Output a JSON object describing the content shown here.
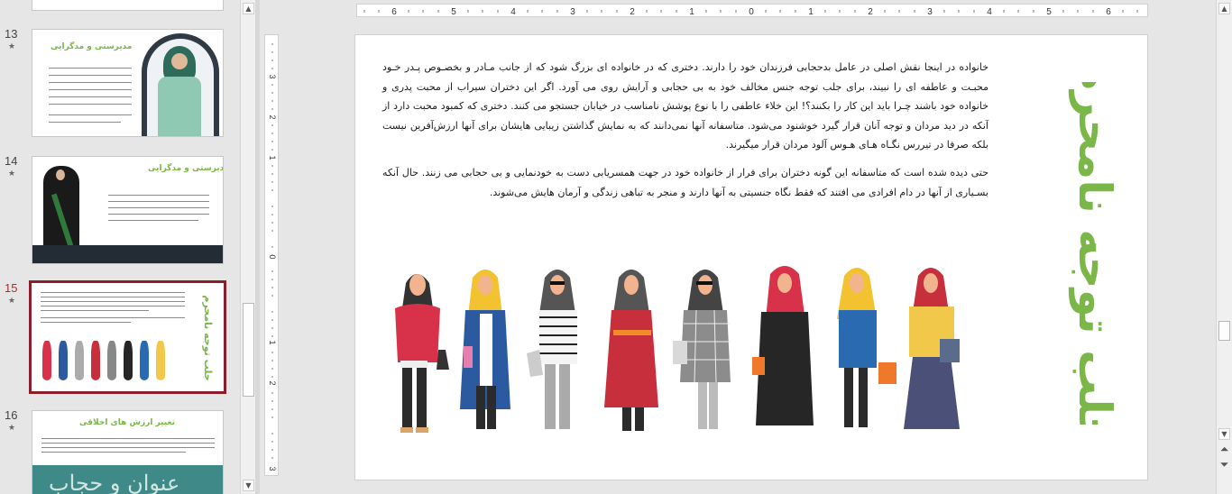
{
  "thumbnails": [
    {
      "num": "13",
      "star": "★",
      "title": "مدیرستی و مدگرایی"
    },
    {
      "num": "14",
      "star": "★",
      "title": "مدیرستی و مدگرایی"
    },
    {
      "num": "15",
      "star": "★",
      "title": "جلب توجه نامحرم"
    },
    {
      "num": "16",
      "star": "★",
      "title": "تغییر ارزش های اخلاقی",
      "image_text": "عنوان و حجاب"
    }
  ],
  "ruler": {
    "horizontal_ticks": [
      "6",
      "5",
      "4",
      "3",
      "2",
      "1",
      "0",
      "1",
      "2",
      "3",
      "4",
      "5",
      "6"
    ],
    "vertical_ticks": [
      "3",
      "2",
      "1",
      "0",
      "1",
      "2",
      "3"
    ]
  },
  "slide": {
    "title": "جلب توجه نامحرم",
    "paragraph_1": "خانواده در اینجا نقش اصلی در عامل بدحجابی فرزندان خود را دارند. دختری که در خانواده ای بزرگ شود که از جانب مـادر و بخصـوص پـدر خـود محبـت و عاطفه ای را نبیند، برای جلب توجه جنس مخالف خود به بی حجابی و آرایش روی می آورد. اگر این دختران سیراب از محبت پدری و خانواده خود باشند چـرا باید این کار را بکنند؟! این خلاء عاطفی را با نوع پوشش نامناسب در خیابان جستجو می کنند. دختری که کمبود محبت دارد از آنکه در دید مردان و توجه آنان قرار گیرد خوشنود می‌شود. متاسفانه آنها نمی‌دانند که به نمایش گذاشتن زیبایی هایشان برای آنها ارزش‌آفرین نیست بلکه صرفا در تیررس نگـاه هـای هـوس آلود مردان قرار میگیرند.",
    "paragraph_2": "حتی دیده شده است که متاسفانه این گونه دختران برای فرار از خانواده خود در جهت همسریابی دست به خودنمایی و بی حجابی می زنند. حال آنکه بسـیاری از آنها در دام افرادی می افتند که فقط نگاه جنسیتی به آنها دارند و منجر به تباهی زندگی و آرمان هایش می‌شوند."
  },
  "colors": {
    "accent_green": "#7ab648",
    "active_thumb_border": "#8b1e2b",
    "active_num": "#b22a2a"
  },
  "icons": {
    "scroll_up": "▲",
    "scroll_down": "▼",
    "prev_slide": "⏶",
    "next_slide": "⏷"
  }
}
